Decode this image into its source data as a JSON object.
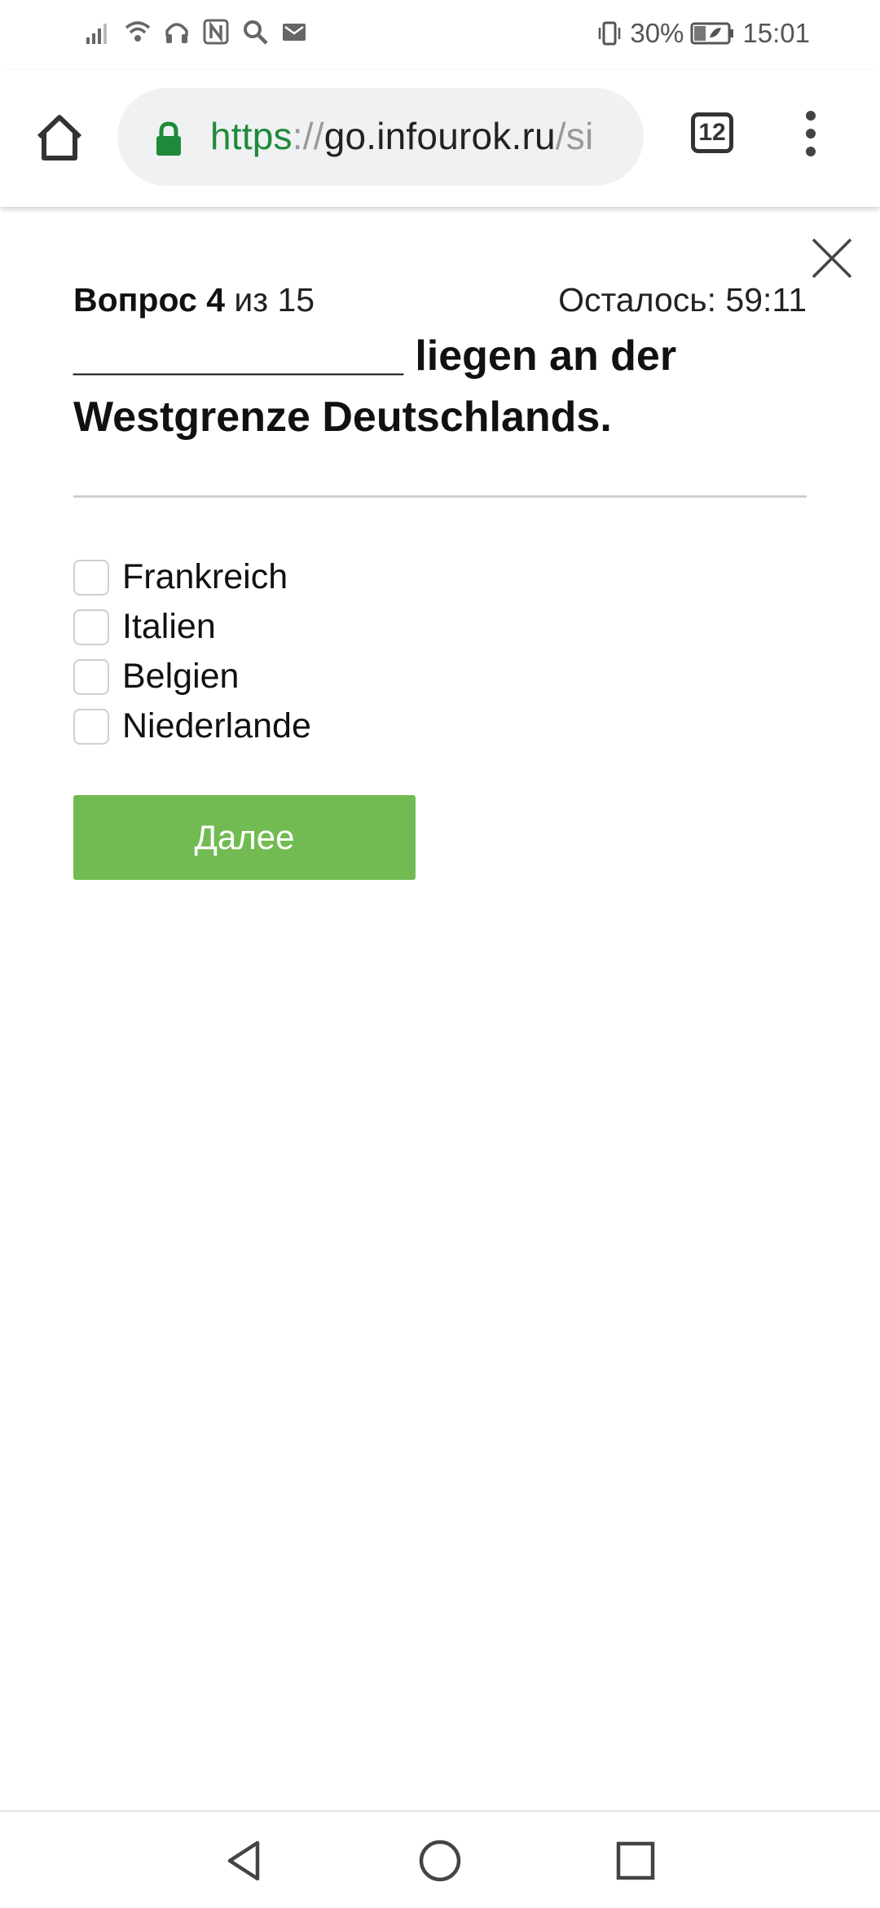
{
  "status_bar": {
    "battery": "30%",
    "time": "15:01",
    "left_icons": [
      "signal-icon",
      "wifi-icon",
      "headset-icon",
      "nfc-icon",
      "search-icon",
      "mail-icon"
    ],
    "right_icons": [
      "vibrate-icon",
      "battery-icon"
    ]
  },
  "browser": {
    "url_scheme": "https",
    "url_sep": "://",
    "url_host": "go.infourok.ru",
    "url_rest": "/si",
    "tab_count": "12",
    "secure_color": "#1e8a3a"
  },
  "quiz": {
    "question_label": "Вопрос",
    "question_number": "4",
    "question_of": "из 15",
    "timer": "Осталось: 59:11",
    "question_text": "______________ liegen an der Westgrenze Deutschlands.",
    "options": [
      "Frankreich",
      "Italien",
      "Belgien",
      "Niederlande"
    ],
    "next_label": "Далее",
    "button_color": "#72bb53"
  }
}
